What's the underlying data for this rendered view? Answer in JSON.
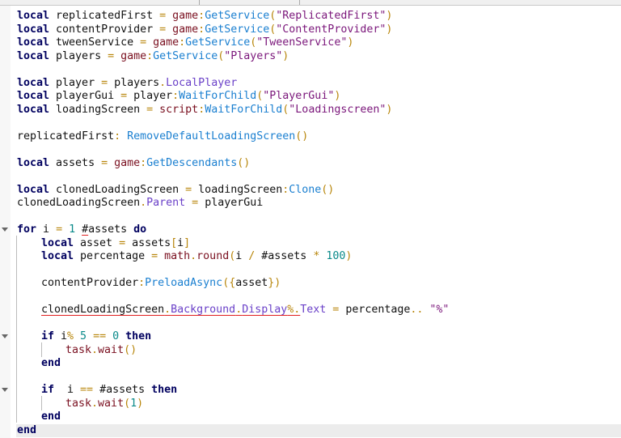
{
  "editor": {
    "lines": [
      {
        "indent": 0,
        "tokens": [
          [
            "kw",
            "local"
          ],
          [
            "id",
            " replicatedFirst "
          ],
          [
            "op",
            "="
          ],
          [
            "svc",
            " game"
          ],
          [
            "op",
            ":"
          ],
          [
            "fn",
            "GetService"
          ],
          [
            "op",
            "("
          ],
          [
            "str",
            "\"ReplicatedFirst\""
          ],
          [
            "op",
            ")"
          ]
        ]
      },
      {
        "indent": 0,
        "tokens": [
          [
            "kw",
            "local"
          ],
          [
            "id",
            " contentProvider "
          ],
          [
            "op",
            "="
          ],
          [
            "svc",
            " game"
          ],
          [
            "op",
            ":"
          ],
          [
            "fn",
            "GetService"
          ],
          [
            "op",
            "("
          ],
          [
            "str",
            "\"ContentProvider\""
          ],
          [
            "op",
            ")"
          ]
        ]
      },
      {
        "indent": 0,
        "tokens": [
          [
            "kw",
            "local"
          ],
          [
            "id",
            " tweenService "
          ],
          [
            "op",
            "="
          ],
          [
            "svc",
            " game"
          ],
          [
            "op",
            ":"
          ],
          [
            "fn",
            "GetService"
          ],
          [
            "op",
            "("
          ],
          [
            "str",
            "\"TweenService\""
          ],
          [
            "op",
            ")"
          ]
        ]
      },
      {
        "indent": 0,
        "tokens": [
          [
            "kw",
            "local"
          ],
          [
            "id",
            " players "
          ],
          [
            "op",
            "="
          ],
          [
            "svc",
            " game"
          ],
          [
            "op",
            ":"
          ],
          [
            "fn",
            "GetService"
          ],
          [
            "op",
            "("
          ],
          [
            "str",
            "\"Players\""
          ],
          [
            "op",
            ")"
          ]
        ]
      },
      {
        "indent": 0,
        "tokens": []
      },
      {
        "indent": 0,
        "tokens": [
          [
            "kw",
            "local"
          ],
          [
            "id",
            " player "
          ],
          [
            "op",
            "="
          ],
          [
            "id",
            " players"
          ],
          [
            "op",
            "."
          ],
          [
            "prop",
            "LocalPlayer"
          ]
        ]
      },
      {
        "indent": 0,
        "tokens": [
          [
            "kw",
            "local"
          ],
          [
            "id",
            " playerGui "
          ],
          [
            "op",
            "="
          ],
          [
            "id",
            " player"
          ],
          [
            "op",
            ":"
          ],
          [
            "fn",
            "WaitForChild"
          ],
          [
            "op",
            "("
          ],
          [
            "str",
            "\"PlayerGui\""
          ],
          [
            "op",
            ")"
          ]
        ]
      },
      {
        "indent": 0,
        "tokens": [
          [
            "kw",
            "local"
          ],
          [
            "id",
            " loadingScreen "
          ],
          [
            "op",
            "="
          ],
          [
            "svc",
            " script"
          ],
          [
            "op",
            ":"
          ],
          [
            "fn",
            "WaitForChild"
          ],
          [
            "op",
            "("
          ],
          [
            "str",
            "\"Loadingscreen\""
          ],
          [
            "op",
            ")"
          ]
        ]
      },
      {
        "indent": 0,
        "tokens": []
      },
      {
        "indent": 0,
        "tokens": [
          [
            "id",
            "replicatedFirst"
          ],
          [
            "op",
            ": "
          ],
          [
            "fn",
            "RemoveDefaultLoadingScreen"
          ],
          [
            "op",
            "()"
          ]
        ]
      },
      {
        "indent": 0,
        "tokens": []
      },
      {
        "indent": 0,
        "tokens": [
          [
            "kw",
            "local"
          ],
          [
            "id",
            " assets "
          ],
          [
            "op",
            "="
          ],
          [
            "svc",
            " game"
          ],
          [
            "op",
            ":"
          ],
          [
            "fn",
            "GetDescendants"
          ],
          [
            "op",
            "()"
          ]
        ]
      },
      {
        "indent": 0,
        "tokens": []
      },
      {
        "indent": 0,
        "tokens": [
          [
            "kw",
            "local"
          ],
          [
            "id",
            " clonedLoadingScreen "
          ],
          [
            "op",
            "="
          ],
          [
            "id",
            " loadingScreen"
          ],
          [
            "op",
            ":"
          ],
          [
            "fn",
            "Clone"
          ],
          [
            "op",
            "()"
          ]
        ]
      },
      {
        "indent": 0,
        "tokens": [
          [
            "id",
            "clonedLoadingScreen"
          ],
          [
            "op",
            "."
          ],
          [
            "prop",
            "Parent"
          ],
          [
            "op",
            " = "
          ],
          [
            "id",
            "playerGui"
          ]
        ]
      },
      {
        "indent": 0,
        "tokens": []
      },
      {
        "indent": 0,
        "fold": true,
        "tokens": [
          [
            "kw",
            "for"
          ],
          [
            "id",
            " i "
          ],
          [
            "op",
            "="
          ],
          [
            "num",
            " 1 "
          ],
          [
            "id",
            "#",
            "err"
          ],
          [
            "id",
            "assets "
          ],
          [
            "kw",
            "do"
          ]
        ]
      },
      {
        "indent": 1,
        "tokens": [
          [
            "kw",
            "local"
          ],
          [
            "id",
            " asset "
          ],
          [
            "op",
            "="
          ],
          [
            "id",
            " assets"
          ],
          [
            "op",
            "["
          ],
          [
            "id",
            "i"
          ],
          [
            "op",
            "]"
          ]
        ]
      },
      {
        "indent": 1,
        "tokens": [
          [
            "kw",
            "local"
          ],
          [
            "id",
            " percentage "
          ],
          [
            "op",
            "="
          ],
          [
            "svc",
            " math"
          ],
          [
            "op",
            "."
          ],
          [
            "svc",
            "round"
          ],
          [
            "op",
            "("
          ],
          [
            "id",
            "i "
          ],
          [
            "op",
            "/"
          ],
          [
            "id",
            " #assets "
          ],
          [
            "op",
            "*"
          ],
          [
            "num",
            " 100"
          ],
          [
            "op",
            ")"
          ]
        ]
      },
      {
        "indent": 1,
        "tokens": []
      },
      {
        "indent": 1,
        "tokens": [
          [
            "id",
            "contentProvider"
          ],
          [
            "op",
            ":"
          ],
          [
            "fn",
            "PreloadAsync"
          ],
          [
            "op",
            "({"
          ],
          [
            "id",
            "asset"
          ],
          [
            "op",
            "})"
          ]
        ]
      },
      {
        "indent": 1,
        "tokens": []
      },
      {
        "indent": 1,
        "tokens": [
          [
            "id",
            "clonedLoadingScreen",
            "err"
          ],
          [
            "op",
            ".",
            "err"
          ],
          [
            "prop",
            "Background",
            "err"
          ],
          [
            "op",
            ".",
            "err"
          ],
          [
            "prop",
            "Display",
            "err"
          ],
          [
            "op",
            "%.",
            "err"
          ],
          [
            "prop",
            "Text"
          ],
          [
            "op",
            " = "
          ],
          [
            "id",
            "percentage"
          ],
          [
            "op",
            ".. "
          ],
          [
            "str",
            "\"%\""
          ]
        ]
      },
      {
        "indent": 1,
        "tokens": []
      },
      {
        "indent": 1,
        "fold": true,
        "tokens": [
          [
            "kw",
            "if"
          ],
          [
            "id",
            " i"
          ],
          [
            "op",
            "%"
          ],
          [
            "num",
            " 5 "
          ],
          [
            "op",
            "=="
          ],
          [
            "num",
            " 0 "
          ],
          [
            "kw",
            "then"
          ]
        ]
      },
      {
        "indent": 2,
        "tokens": [
          [
            "svc",
            "task"
          ],
          [
            "op",
            "."
          ],
          [
            "svc",
            "wait"
          ],
          [
            "op",
            "()"
          ]
        ]
      },
      {
        "indent": 1,
        "tokens": [
          [
            "kw",
            "end"
          ]
        ]
      },
      {
        "indent": 1,
        "tokens": []
      },
      {
        "indent": 1,
        "fold": true,
        "tokens": [
          [
            "kw",
            "if"
          ],
          [
            "id",
            "  i "
          ],
          [
            "op",
            "=="
          ],
          [
            "id",
            " #assets "
          ],
          [
            "kw",
            "then"
          ]
        ]
      },
      {
        "indent": 2,
        "tokens": [
          [
            "svc",
            "task"
          ],
          [
            "op",
            "."
          ],
          [
            "svc",
            "wait"
          ],
          [
            "op",
            "("
          ],
          [
            "num",
            "1"
          ],
          [
            "op",
            ")"
          ]
        ]
      },
      {
        "indent": 1,
        "tokens": [
          [
            "kw",
            "end"
          ]
        ]
      },
      {
        "indent": 0,
        "current": true,
        "tokens": [
          [
            "kw",
            "end"
          ]
        ]
      }
    ]
  }
}
